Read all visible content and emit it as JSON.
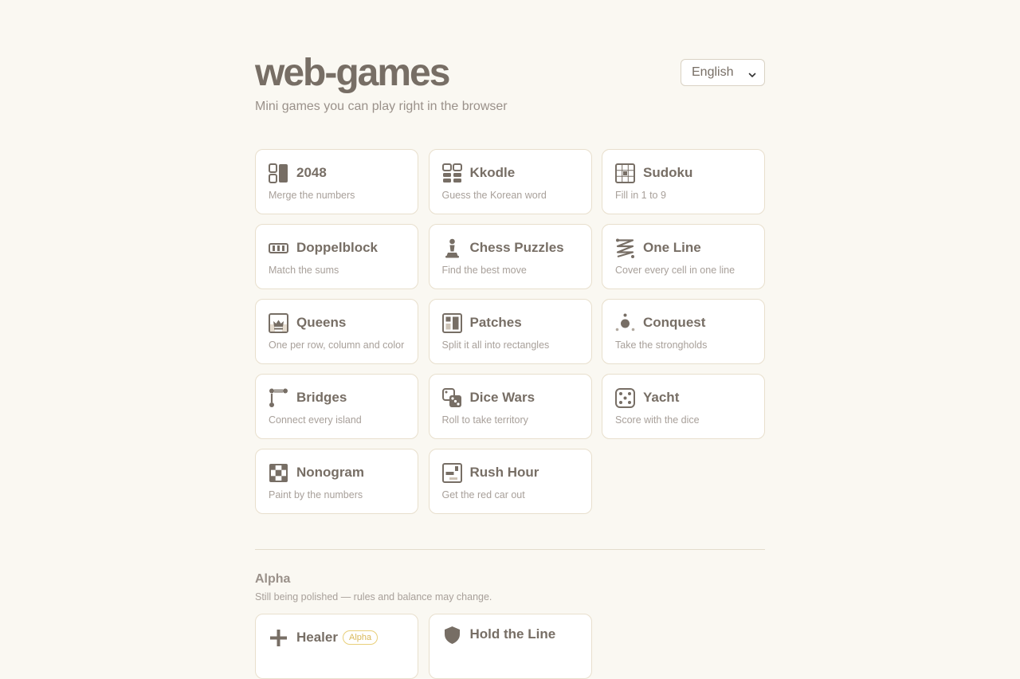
{
  "header": {
    "title": "web-games",
    "subtitle": "Mini games you can play right in the browser",
    "language": "English"
  },
  "games": [
    {
      "id": "2048",
      "name": "2048",
      "desc": "Merge the numbers",
      "icon": "tiles-icon"
    },
    {
      "id": "kkodle",
      "name": "Kkodle",
      "desc": "Guess the Korean word",
      "icon": "blocks-icon"
    },
    {
      "id": "sudoku",
      "name": "Sudoku",
      "desc": "Fill in 1 to 9",
      "icon": "grid-icon"
    },
    {
      "id": "doppelblock",
      "name": "Doppelblock",
      "desc": "Match the sums",
      "icon": "strip-icon"
    },
    {
      "id": "chess-puzzles",
      "name": "Chess Puzzles",
      "desc": "Find the best move",
      "icon": "pawn-icon"
    },
    {
      "id": "one-line",
      "name": "One Line",
      "desc": "Cover every cell in one line",
      "icon": "zigzag-icon"
    },
    {
      "id": "queens",
      "name": "Queens",
      "desc": "One per row, column and color",
      "icon": "crown-icon"
    },
    {
      "id": "patches",
      "name": "Patches",
      "desc": "Split it all into rectangles",
      "icon": "rectangles-icon"
    },
    {
      "id": "conquest",
      "name": "Conquest",
      "desc": "Take the strongholds",
      "icon": "nodes-icon"
    },
    {
      "id": "bridges",
      "name": "Bridges",
      "desc": "Connect every island",
      "icon": "bridge-icon"
    },
    {
      "id": "dice-wars",
      "name": "Dice Wars",
      "desc": "Roll to take territory",
      "icon": "dice-pair-icon"
    },
    {
      "id": "yacht",
      "name": "Yacht",
      "desc": "Score with the dice",
      "icon": "die-icon"
    },
    {
      "id": "nonogram",
      "name": "Nonogram",
      "desc": "Paint by the numbers",
      "icon": "checker-icon"
    },
    {
      "id": "rush-hour",
      "name": "Rush Hour",
      "desc": "Get the red car out",
      "icon": "car-grid-icon"
    }
  ],
  "alpha": {
    "title": "Alpha",
    "subtitle": "Still being polished — rules and balance may change.",
    "badge": "Alpha",
    "games": [
      {
        "id": "healer",
        "name": "Healer",
        "icon": "plus-icon"
      },
      {
        "id": "hold-the-line",
        "name": "Hold the Line",
        "icon": "shield-icon"
      }
    ]
  },
  "colors": {
    "background": "#faf8f2",
    "text": "#776e65",
    "muted": "#a8a09a",
    "card_border": "#e8dfcd",
    "badge": "#d9b85a"
  }
}
